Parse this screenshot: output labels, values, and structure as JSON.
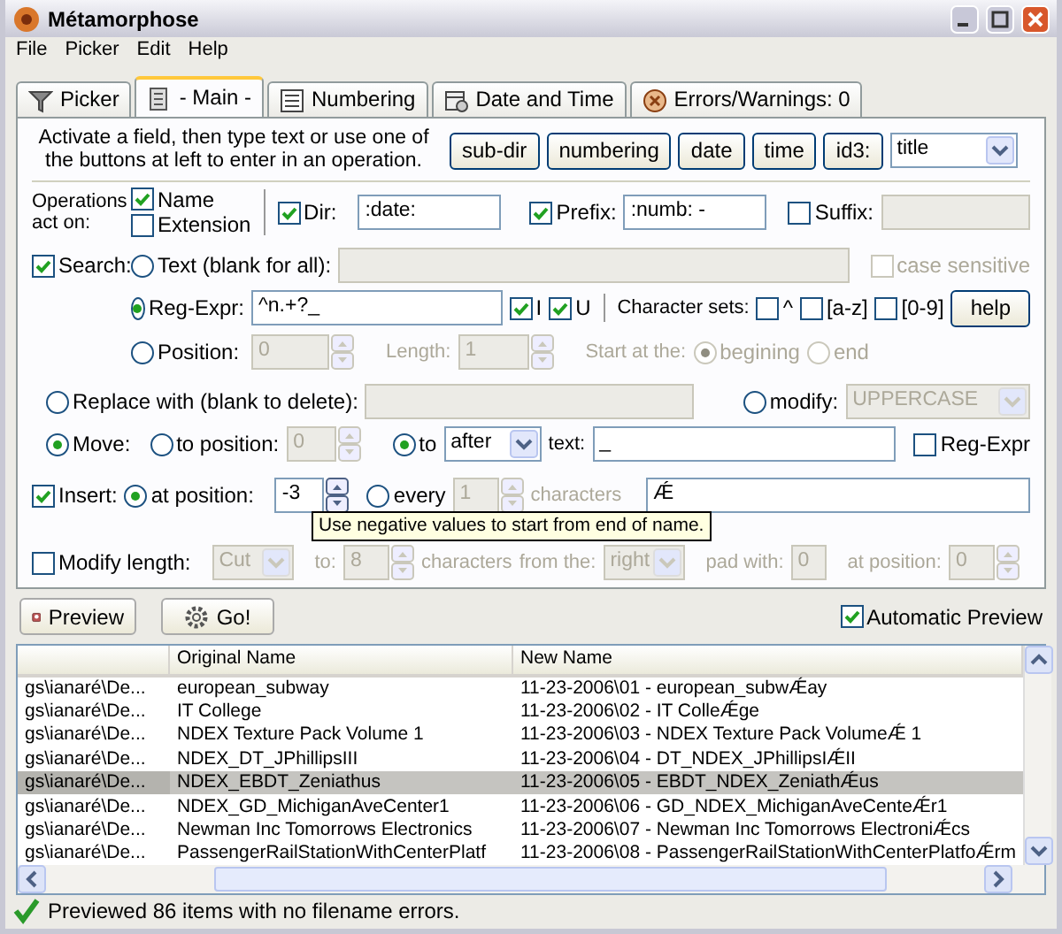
{
  "window": {
    "title": "Métamorphose"
  },
  "menu": [
    "File",
    "Picker",
    "Edit",
    "Help"
  ],
  "tabs": [
    {
      "label": "Picker",
      "selected": false,
      "kind": "funnel"
    },
    {
      "label": "- Main -",
      "selected": true,
      "kind": "document"
    },
    {
      "label": "Numbering",
      "selected": false,
      "kind": "list"
    },
    {
      "label": "Date and Time",
      "selected": false,
      "kind": "calendar"
    },
    {
      "label": "Errors/Warnings: 0",
      "selected": false,
      "kind": "error"
    }
  ],
  "instructions": "Activate a field, then type text or use one of the buttons at left to enter in an operation.",
  "insert_buttons": [
    "sub-dir",
    "numbering",
    "date",
    "time",
    "id3:"
  ],
  "id3_field": {
    "value": "title"
  },
  "operations": {
    "label": "Operations act on:",
    "name": {
      "label": "Name",
      "checked": true
    },
    "extension": {
      "label": "Extension",
      "checked": false
    }
  },
  "dir": {
    "label": "Dir:",
    "checked": true,
    "value": ":date:"
  },
  "prefix": {
    "label": "Prefix:",
    "checked": true,
    "value": ":numb: -"
  },
  "suffix": {
    "label": "Suffix:",
    "checked": false
  },
  "search": {
    "label": "Search:",
    "checked": true
  },
  "text_option": {
    "label": "Text (blank for all):",
    "selected": false
  },
  "case_sensitive": {
    "label": "case sensitive",
    "checked": false
  },
  "regexp": {
    "label": "Reg-Expr:",
    "selected": true,
    "value": "^n.+?_",
    "flags": [
      {
        "label": "I",
        "checked": true
      },
      {
        "label": "U",
        "checked": true
      }
    ]
  },
  "char_sets": {
    "label": "Character sets:",
    "options": [
      {
        "label": "^",
        "checked": false
      },
      {
        "label": "[a-z]",
        "checked": false
      },
      {
        "label": "[0-9]",
        "checked": false
      }
    ]
  },
  "help_button": "help",
  "position": {
    "label": "Position:",
    "selected": false,
    "value": "0",
    "length_label": "Length:",
    "length_value": "1",
    "start_label": "Start at the:",
    "start_options": [
      {
        "label": "begining",
        "selected": true
      },
      {
        "label": "end",
        "selected": false
      }
    ]
  },
  "replace": {
    "label": "Replace with (blank to delete):",
    "selected": false
  },
  "modify": {
    "label": "modify:",
    "selected": false,
    "value": "UPPERCASE"
  },
  "move": {
    "label": "Move:",
    "selected": true,
    "to_position": {
      "label": "to position:",
      "selected": false,
      "value": "0"
    },
    "to": {
      "label": "to",
      "selected": true,
      "value": "after"
    },
    "text_label": "text:",
    "text_value": "_",
    "regexpr": {
      "label": "Reg-Expr",
      "checked": false
    }
  },
  "insert": {
    "label": "Insert:",
    "checked": true,
    "at_position": {
      "label": "at position:",
      "selected": true,
      "value": "-3"
    },
    "every": {
      "label": "every",
      "selected": false,
      "value": "1"
    },
    "characters_label": "characters",
    "value": "Ǽ"
  },
  "tooltip": "Use negative values to start from end of name.",
  "modify_length": {
    "label": "Modify length:",
    "checked": false,
    "mode": "Cut",
    "to_label": "to:",
    "to_value": "8",
    "characters_label": "characters",
    "from_label": "from the:",
    "from_value": "right",
    "pad_label": "pad with:",
    "pad_value": "0",
    "at_label": "at position:",
    "at_value": "0"
  },
  "preview_button": "Preview",
  "go_button": "Go!",
  "auto_preview": {
    "label": "Automatic Preview",
    "checked": true
  },
  "table": {
    "columns": [
      "Original Name",
      "New Name"
    ],
    "rows": [
      {
        "path": "gs\\ianaré\\De...",
        "original": "european_subway",
        "new": "11-23-2006\\01 - european_subwǼay",
        "selected": false
      },
      {
        "path": "gs\\ianaré\\De...",
        "original": "IT College",
        "new": "11-23-2006\\02 - IT ColleǼge",
        "selected": false
      },
      {
        "path": "gs\\ianaré\\De...",
        "original": "NDEX Texture Pack Volume 1",
        "new": "11-23-2006\\03 - NDEX Texture Pack VolumeǼ 1",
        "selected": false
      },
      {
        "path": "gs\\ianaré\\De...",
        "original": "NDEX_DT_JPhillipsIII",
        "new": "11-23-2006\\04 - DT_NDEX_JPhillipsIǼII",
        "selected": false
      },
      {
        "path": "gs\\ianaré\\De...",
        "original": "NDEX_EBDT_Zeniathus",
        "new": "11-23-2006\\05 - EBDT_NDEX_ZeniathǼus",
        "selected": true
      },
      {
        "path": "gs\\ianaré\\De...",
        "original": "NDEX_GD_MichiganAveCenter1",
        "new": "11-23-2006\\06 - GD_NDEX_MichiganAveCenteǼr1",
        "selected": false
      },
      {
        "path": "gs\\ianaré\\De...",
        "original": "Newman Inc Tomorrows Electronics",
        "new": "11-23-2006\\07 - Newman Inc Tomorrows ElectroniǼcs",
        "selected": false
      },
      {
        "path": "gs\\ianaré\\De...",
        "original": "PassengerRailStationWithCenterPlatf",
        "new": "11-23-2006\\08 - PassengerRailStationWithCenterPlatfoǼrm",
        "selected": false
      }
    ]
  },
  "status_bar": "Previewed 86 items with no filename errors."
}
